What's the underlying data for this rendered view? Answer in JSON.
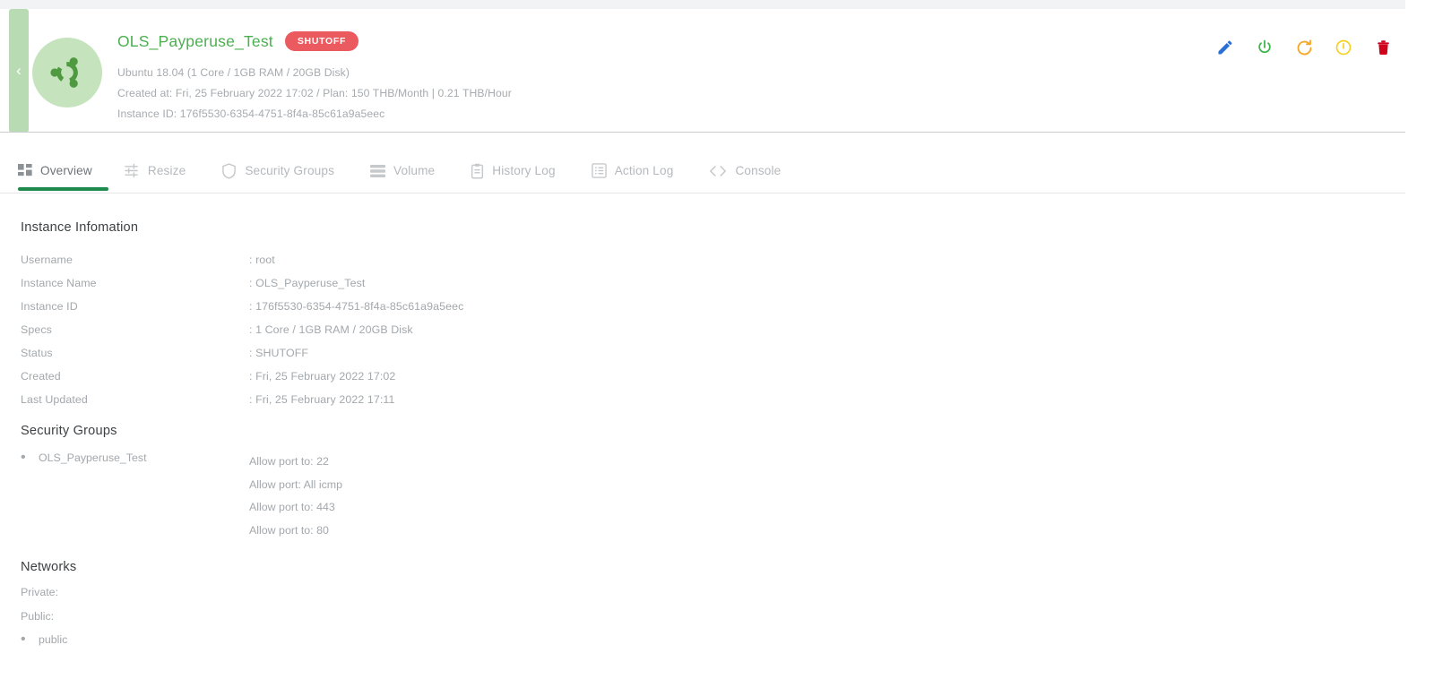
{
  "instance": {
    "name": "OLS_Payperuse_Test",
    "status_badge": "SHUTOFF",
    "os_line": "Ubuntu 18.04 (1 Core / 1GB RAM / 20GB Disk)",
    "created_plan_line": "Created at: Fri, 25 February 2022 17:02 / Plan: 150 THB/Month | 0.21 THB/Hour",
    "instance_id_line": "Instance ID: 176f5530-6354-4751-8f4a-85c61a9a5eec",
    "os_icon": "ubuntu-icon"
  },
  "header_actions": [
    {
      "name": "edit-button",
      "icon": "pencil-icon",
      "color": "#2a6fd6"
    },
    {
      "name": "power-button",
      "icon": "power-icon",
      "color": "#3bb54a"
    },
    {
      "name": "reboot-button",
      "icon": "refresh-icon",
      "color": "#f5a623"
    },
    {
      "name": "shutdown-button",
      "icon": "power-circle-icon",
      "color": "#f5d020"
    },
    {
      "name": "delete-button",
      "icon": "trash-icon",
      "color": "#d0021b"
    }
  ],
  "sidebar_toggle": {
    "name": "collapse-sidebar-button",
    "icon": "chevron-left-icon"
  },
  "tabs": [
    {
      "label": "Overview",
      "icon": "grid-icon",
      "active": true
    },
    {
      "label": "Resize",
      "icon": "sliders-icon",
      "active": false
    },
    {
      "label": "Security Groups",
      "icon": "shield-icon",
      "active": false
    },
    {
      "label": "Volume",
      "icon": "stack-icon",
      "active": false
    },
    {
      "label": "History Log",
      "icon": "clipboard-icon",
      "active": false
    },
    {
      "label": "Action Log",
      "icon": "list-icon",
      "active": false
    },
    {
      "label": "Console",
      "icon": "code-icon",
      "active": false
    }
  ],
  "instance_information": {
    "title": "Instance Infomation",
    "rows": [
      {
        "key": "Username",
        "value": ": root"
      },
      {
        "key": "Instance Name",
        "value": ": OLS_Payperuse_Test"
      },
      {
        "key": "Instance ID",
        "value": ": 176f5530-6354-4751-8f4a-85c61a9a5eec"
      },
      {
        "key": "Specs",
        "value": ": 1 Core / 1GB RAM / 20GB Disk"
      },
      {
        "key": "Status",
        "value": ": SHUTOFF"
      },
      {
        "key": "Created",
        "value": ": Fri, 25 February 2022 17:02"
      },
      {
        "key": "Last Updated",
        "value": ": Fri, 25 February 2022 17:11"
      }
    ]
  },
  "security_groups": {
    "title": "Security Groups",
    "group_name": "OLS_Payperuse_Test",
    "rules": [
      "Allow port to: 22",
      "Allow port: All icmp",
      "Allow port to: 443",
      "Allow port to: 80"
    ]
  },
  "networks": {
    "title": "Networks",
    "private_label": "Private:",
    "public_label": "Public:",
    "public_items": [
      "public"
    ]
  },
  "colors": {
    "accent_green": "#1f8a4c",
    "title_green": "#4caf50",
    "status_red": "#ea5a5f",
    "band_green": "#b9dbb4"
  }
}
